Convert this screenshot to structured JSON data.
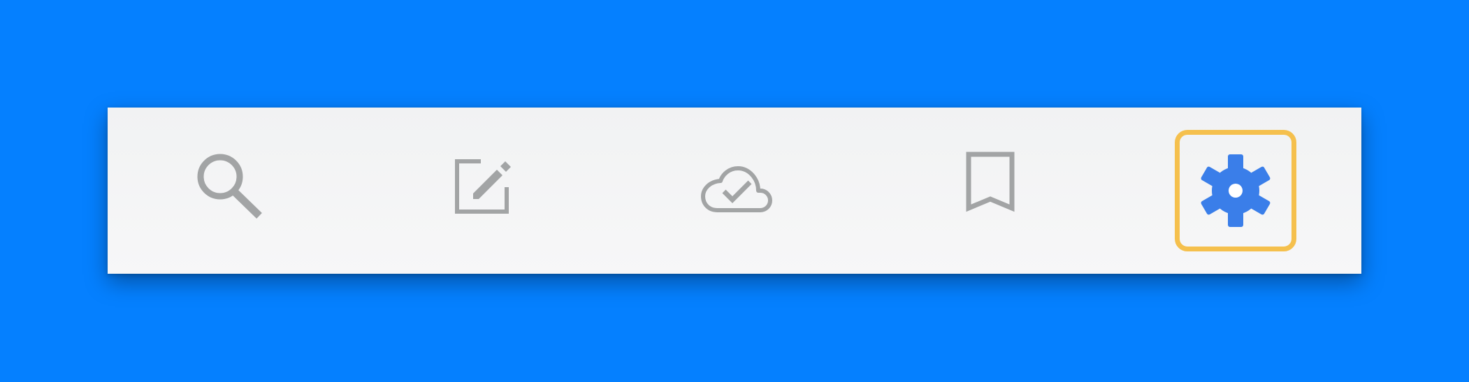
{
  "colors": {
    "background": "#0580ff",
    "icon_inactive": "#a2a4a5",
    "icon_active": "#3a7ee9",
    "selection_border": "#f5c04d"
  },
  "toolbar": {
    "items": [
      {
        "icon": "search-icon",
        "selected": false
      },
      {
        "icon": "compose-icon",
        "selected": false
      },
      {
        "icon": "cloud-done-icon",
        "selected": false
      },
      {
        "icon": "bookmark-icon",
        "selected": false
      },
      {
        "icon": "gear-icon",
        "selected": true
      }
    ]
  }
}
